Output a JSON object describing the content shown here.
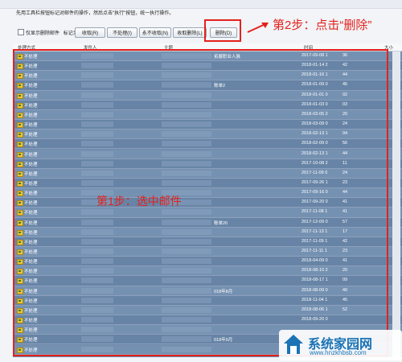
{
  "instruction": "先用工具栏按钮标记对邮件的操作，然后点击\"执行\"按钮，统一执行操作。",
  "toolbar": {
    "only_show_label": "仅显示删除邮件",
    "mark_as_label": "标记为:",
    "buttons": [
      "收取(R)",
      "不处理(I)",
      "永不收取(N)",
      "收取删除(L)",
      "删除(D)"
    ]
  },
  "annotations": {
    "step1": "第1步：选中邮件",
    "step2": "第2步：点击“删除”",
    "highlight_color": "#e3221d"
  },
  "columns": [
    "处理方式",
    "发件人",
    "主题",
    "时间",
    "大小"
  ],
  "rows": [
    {
      "status": "不处理",
      "date": "2017-09-08 1",
      "size": "36",
      "subject_fragment": "拓展职业人脉"
    },
    {
      "status": "不处理",
      "date": "2018-01-14 2",
      "size": "42",
      "subject_fragment": ""
    },
    {
      "status": "不处理",
      "date": "2018-01-16 1",
      "size": "44",
      "subject_fragment": ""
    },
    {
      "status": "不处理",
      "date": "2018-01-09 0",
      "size": "45",
      "subject_fragment": "账单2"
    },
    {
      "status": "不处理",
      "date": "2018-01-01 0",
      "size": "02",
      "subject_fragment": ""
    },
    {
      "status": "不处理",
      "date": "2018-01-03 0",
      "size": "03",
      "subject_fragment": ""
    },
    {
      "status": "不处理",
      "date": "2018-03-05 2",
      "size": "20",
      "subject_fragment": ""
    },
    {
      "status": "不处理",
      "date": "2018-03-09 0",
      "size": "24",
      "subject_fragment": ""
    },
    {
      "status": "不处理",
      "date": "2018-02-13 1",
      "size": "04",
      "subject_fragment": ""
    },
    {
      "status": "不处理",
      "date": "2018-02-09 0",
      "size": "56",
      "subject_fragment": ""
    },
    {
      "status": "不处理",
      "date": "2018-02-13 1",
      "size": "44",
      "subject_fragment": ""
    },
    {
      "status": "不处理",
      "date": "2017-10-08 2",
      "size": "11",
      "subject_fragment": ""
    },
    {
      "status": "不处理",
      "date": "2017-11-09 0",
      "size": "24",
      "subject_fragment": ""
    },
    {
      "status": "不处理",
      "date": "2017-09-26 1",
      "size": "23",
      "subject_fragment": ""
    },
    {
      "status": "不处理",
      "date": "2017-09-16 0",
      "size": "44",
      "subject_fragment": ""
    },
    {
      "status": "不处理",
      "date": "2017-09-20 0",
      "size": "41",
      "subject_fragment": ""
    },
    {
      "status": "不处理",
      "date": "2017-11-08 1",
      "size": "41",
      "subject_fragment": ""
    },
    {
      "status": "不处理",
      "date": "2017-12-09 0",
      "size": "57",
      "subject_fragment": "账单20"
    },
    {
      "status": "不处理",
      "date": "2017-11-13 1",
      "size": "17",
      "subject_fragment": ""
    },
    {
      "status": "不处理",
      "date": "2017-11-09 1",
      "size": "42",
      "subject_fragment": ""
    },
    {
      "status": "不处理",
      "date": "2017-11-11 1",
      "size": "23",
      "subject_fragment": ""
    },
    {
      "status": "不处理",
      "date": "2018-04-09 0",
      "size": "41",
      "subject_fragment": ""
    },
    {
      "status": "不处理",
      "date": "2018-08-10 2",
      "size": "20",
      "subject_fragment": ""
    },
    {
      "status": "不处理",
      "date": "2018-08-17 1",
      "size": "09",
      "subject_fragment": ""
    },
    {
      "status": "不处理",
      "date": "2018-08-09 0",
      "size": "40",
      "subject_fragment": "018年8月"
    },
    {
      "status": "不处理",
      "date": "2018-11-04 1",
      "size": "45",
      "subject_fragment": ""
    },
    {
      "status": "不处理",
      "date": "2018-08-06 1",
      "size": "52",
      "subject_fragment": ""
    },
    {
      "status": "不处理",
      "date": "2018-09-20 0",
      "size": "",
      "subject_fragment": ""
    },
    {
      "status": "不处理",
      "date": "",
      "size": "",
      "subject_fragment": ""
    },
    {
      "status": "不处理",
      "date": "",
      "size": "",
      "subject_fragment": "018年9月"
    },
    {
      "status": "不处理",
      "date": "",
      "size": "",
      "subject_fragment": ""
    }
  ],
  "watermark": {
    "title": "系统家园网",
    "url": "www.hnzkhbsb.com"
  }
}
